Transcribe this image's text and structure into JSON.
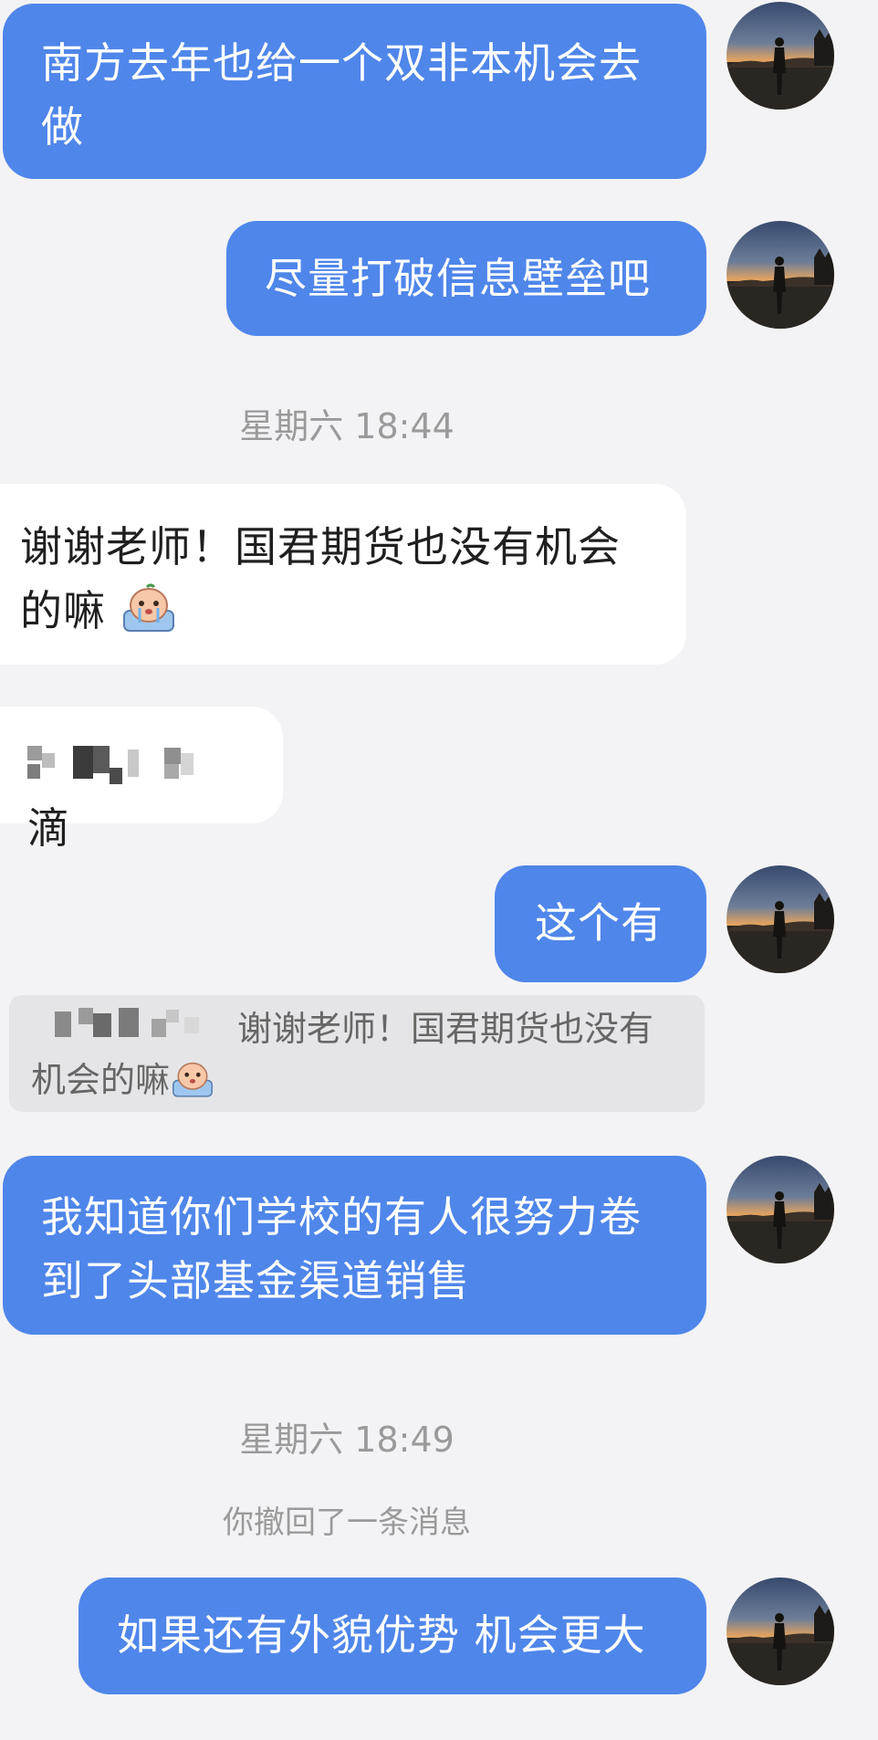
{
  "messages": [
    {
      "id": "m1",
      "direction": "out",
      "text": "南方去年也给一个双非本机会去做"
    },
    {
      "id": "m2",
      "direction": "out",
      "text": "尽量打破信息壁垒吧"
    },
    {
      "id": "ts1",
      "type": "timestamp",
      "text": "星期六 18:44"
    },
    {
      "id": "m3",
      "direction": "in",
      "text": "谢谢老师！国君期货也没有机会的嘛",
      "emoji": "crying-emoji"
    },
    {
      "id": "m4",
      "direction": "in",
      "text": "滴",
      "redacted_prefix": true
    },
    {
      "id": "m5",
      "direction": "out",
      "text": "这个有"
    },
    {
      "id": "q1",
      "type": "quote",
      "text": "谢谢老师！国君期货也没有机会的嘛",
      "emoji": "crying-emoji",
      "redacted_sender": true
    },
    {
      "id": "m6",
      "direction": "out",
      "text": "我知道你们学校的有人很努力卷到了头部基金渠道销售"
    },
    {
      "id": "ts2",
      "type": "timestamp",
      "text": "星期六 18:49"
    },
    {
      "id": "n1",
      "type": "notice",
      "text": "你撤回了一条消息"
    },
    {
      "id": "m7",
      "direction": "out",
      "text": "如果还有外貌优势 机会更大"
    }
  ],
  "colors": {
    "outgoing_bubble": "#4f86ea",
    "incoming_bubble": "#ffffff",
    "background": "#f3f3f5",
    "meta_text": "#9a9a9a"
  },
  "icons": [
    "avatar-sunset-photo",
    "crying-emoji",
    "pixelated-name"
  ]
}
